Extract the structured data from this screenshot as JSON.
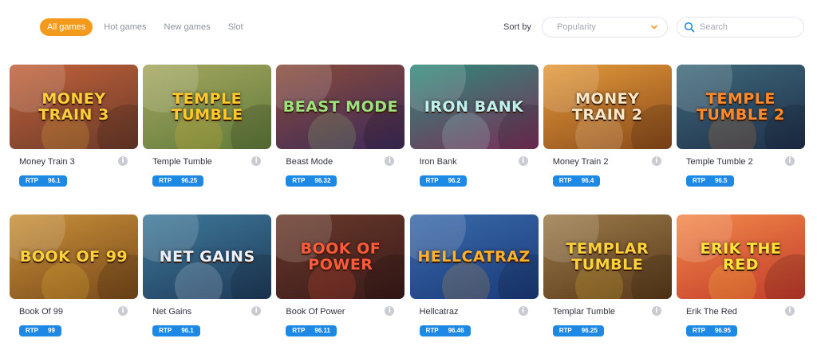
{
  "filters": {
    "tabs": [
      {
        "label": "All games",
        "active": true
      },
      {
        "label": "Hot games",
        "active": false
      },
      {
        "label": "New games",
        "active": false
      },
      {
        "label": "Slot",
        "active": false
      }
    ]
  },
  "sort": {
    "label": "Sort by",
    "selected": "Popularity"
  },
  "search": {
    "placeholder": "Search",
    "value": ""
  },
  "colors": {
    "accent": "#f39a1d",
    "rtp_badge": "#1e88e5",
    "info_icon": "#c9ccd3"
  },
  "rtp_label": "RTP",
  "games": [
    {
      "name": "Money Train 3",
      "rtp": "96.1",
      "art_text": "MONEY TRAIN 3",
      "bg1": "#6a3a2a",
      "bg2": "#c2623a",
      "fg": "#ffcf3a"
    },
    {
      "name": "Temple Tumble",
      "rtp": "96.25",
      "art_text": "TEMPLE TUMBLE",
      "bg1": "#5f7a3a",
      "bg2": "#a6a760",
      "fg": "#ffc82b"
    },
    {
      "name": "Beast Mode",
      "rtp": "96.32",
      "art_text": "BEAST MODE",
      "bg1": "#3d2a5a",
      "bg2": "#8a4c3a",
      "fg": "#9be27a"
    },
    {
      "name": "Iron Bank",
      "rtp": "96.2",
      "art_text": "IRON BANK",
      "bg1": "#7a2f5a",
      "bg2": "#2f8a7a",
      "fg": "#bff2ef"
    },
    {
      "name": "Money Train 2",
      "rtp": "96.4",
      "art_text": "MONEY TRAIN 2",
      "bg1": "#8a4a1a",
      "bg2": "#e49a3a",
      "fg": "#f7e7c7"
    },
    {
      "name": "Temple Tumble 2",
      "rtp": "96.5",
      "art_text": "TEMPLE TUMBLE 2",
      "bg1": "#1f2f4a",
      "bg2": "#3f6a7a",
      "fg": "#ff8a2a"
    },
    {
      "name": "Book Of 99",
      "rtp": "99",
      "art_text": "BOOK OF 99",
      "bg1": "#7a4a1a",
      "bg2": "#c8913a",
      "fg": "#ffd23a"
    },
    {
      "name": "Net Gains",
      "rtp": "96.1",
      "art_text": "NET GAINS",
      "bg1": "#1f3a5a",
      "bg2": "#3f7a9a",
      "fg": "#e8f2ff"
    },
    {
      "name": "Book Of Power",
      "rtp": "96.11",
      "art_text": "BOOK OF POWER",
      "bg1": "#3a1a1a",
      "bg2": "#6a3a2a",
      "fg": "#ff5a3a"
    },
    {
      "name": "Hellcatraz",
      "rtp": "96.46",
      "art_text": "HELLCATRAZ",
      "bg1": "#1a3a7a",
      "bg2": "#3a6aaa",
      "fg": "#ffb02a"
    },
    {
      "name": "Templar Tumble",
      "rtp": "96.25",
      "art_text": "TEMPLAR TUMBLE",
      "bg1": "#5a3a1a",
      "bg2": "#9a7a4a",
      "fg": "#ffd23a"
    },
    {
      "name": "Erik The Red",
      "rtp": "96.95",
      "art_text": "ERIK THE RED",
      "bg1": "#c23a2a",
      "bg2": "#f28a4a",
      "fg": "#ffe23a"
    }
  ]
}
